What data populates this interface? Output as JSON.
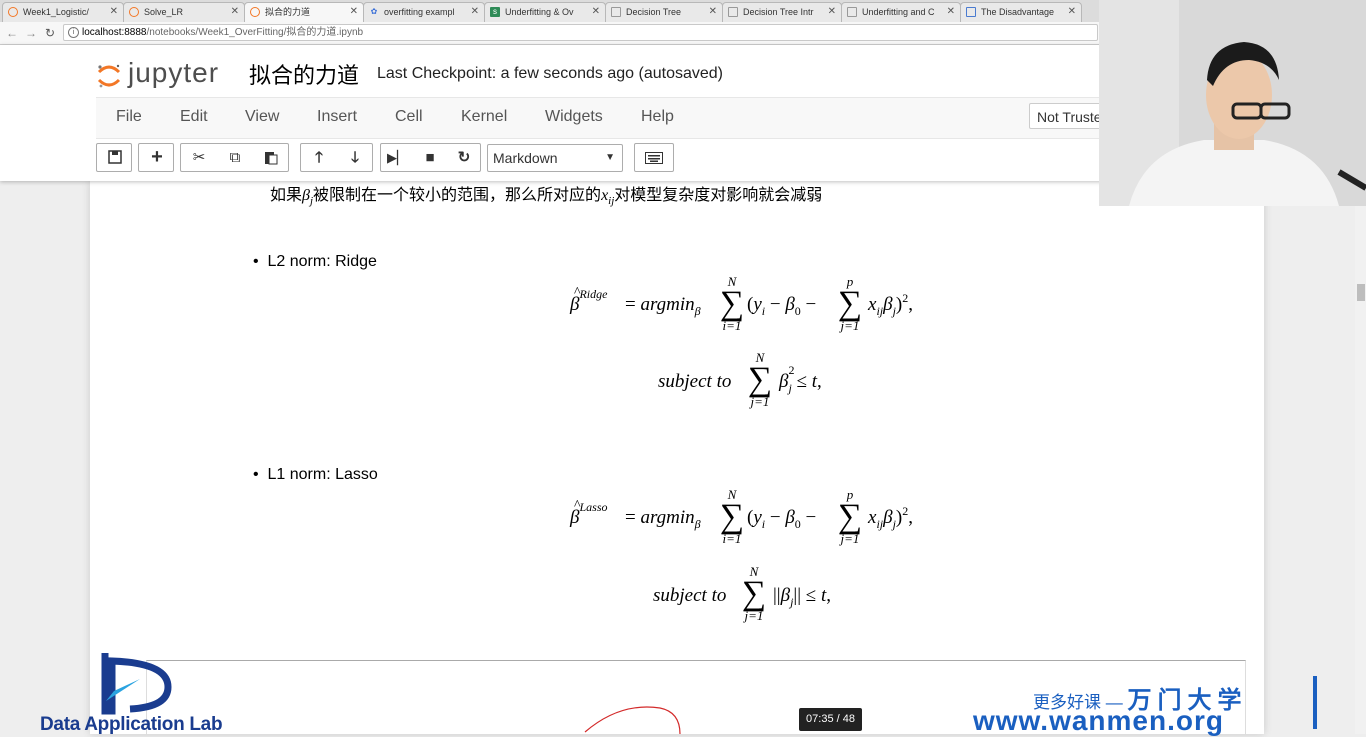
{
  "browser": {
    "tabs": [
      {
        "title": "Week1_Logistic/",
        "icon": "jupyter-icon"
      },
      {
        "title": "Solve_LR",
        "icon": "jupyter-icon"
      },
      {
        "title": "拟合的力道",
        "icon": "jupyter-icon",
        "active": true
      },
      {
        "title": "overfitting exampl",
        "icon": "gear-icon"
      },
      {
        "title": "Underfitting & Ov",
        "icon": "sheet-icon"
      },
      {
        "title": "Decision Tree",
        "icon": "page-icon"
      },
      {
        "title": "Decision Tree Intr",
        "icon": "page-icon"
      },
      {
        "title": "Underfitting and C",
        "icon": "page-icon"
      },
      {
        "title": "The Disadvantage",
        "icon": "page-icon"
      }
    ],
    "url_host": "localhost:8888",
    "url_path": "/notebooks/Week1_OverFitting/拟合的力道.ipynb"
  },
  "jupyter": {
    "logo_text": "jupyter",
    "notebook_title": "拟合的力道",
    "checkpoint": "Last Checkpoint: a few seconds ago (autosaved)",
    "menu": [
      "File",
      "Edit",
      "View",
      "Insert",
      "Cell",
      "Kernel",
      "Widgets",
      "Help"
    ],
    "trust_label": "Not Trusted",
    "cell_type": "Markdown"
  },
  "content": {
    "intro_pre": "如果",
    "intro_beta": "β",
    "intro_beta_sub": "j",
    "intro_mid": "被限制在一个较小的范围，那么所对应的",
    "intro_x": "x",
    "intro_x_sub": "ij",
    "intro_post": "对模型复杂度对影响就会减弱",
    "l2_label": "L2 norm: Ridge",
    "l1_label": "L1 norm: Lasso",
    "ridge_sup": "Ridge",
    "lasso_sup": "Lasso",
    "argmin": "argmin",
    "subject_to": "subject to",
    "sum_upper_N": "N",
    "sum_upper_p": "p",
    "sum_lower_i": "i=1",
    "sum_lower_j": "j=1"
  },
  "overlays": {
    "dal_text": "Data Application Lab",
    "wm_tagline": "更多好课 —",
    "wm_brand": "万门大学",
    "wm_url": "www.wanmen.org",
    "timecode": "07:35 / 48"
  },
  "colors": {
    "jupyter_orange": "#f37726",
    "brand_blue": "#1a5fc0",
    "dal_blue": "#1a3c8f"
  }
}
